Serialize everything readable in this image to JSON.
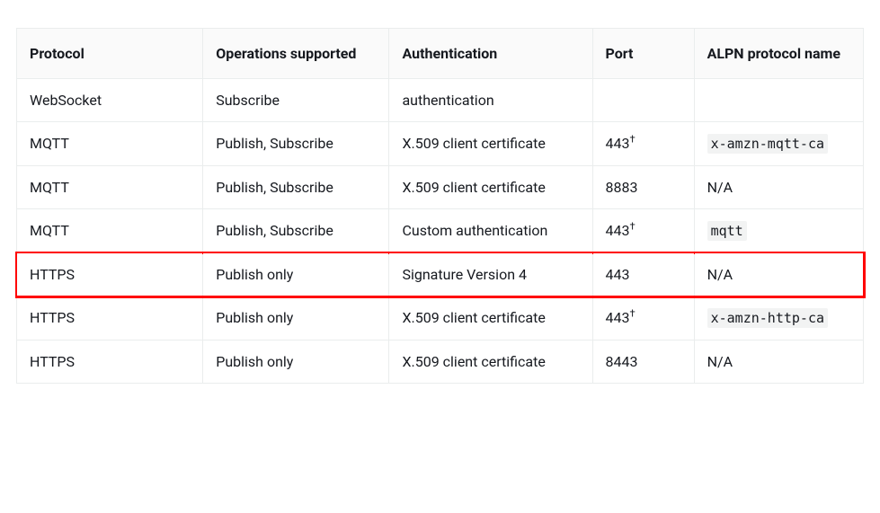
{
  "table": {
    "headers": {
      "protocol": "Protocol",
      "operations": "Operations supported",
      "auth": "Authentication",
      "port": "Port",
      "alpn": "ALPN protocol name"
    },
    "rows": [
      {
        "protocol": "WebSocket",
        "operations": "Subscribe",
        "auth": "authentication",
        "port": "",
        "port_dagger": false,
        "alpn": "",
        "alpn_code": false,
        "highlighted": false
      },
      {
        "protocol": "MQTT",
        "operations": "Publish, Subscribe",
        "auth": "X.509 client certificate",
        "port": "443",
        "port_dagger": true,
        "alpn": "x-amzn-mqtt-ca",
        "alpn_code": true,
        "highlighted": false
      },
      {
        "protocol": "MQTT",
        "operations": "Publish, Subscribe",
        "auth": "X.509 client certificate",
        "port": "8883",
        "port_dagger": false,
        "alpn": "N/A",
        "alpn_code": false,
        "highlighted": false
      },
      {
        "protocol": "MQTT",
        "operations": "Publish, Subscribe",
        "auth": "Custom authentication",
        "port": "443",
        "port_dagger": true,
        "alpn": "mqtt",
        "alpn_code": true,
        "highlighted": false
      },
      {
        "protocol": "HTTPS",
        "operations": "Publish only",
        "auth": "Signature Version 4",
        "port": "443",
        "port_dagger": false,
        "alpn": "N/A",
        "alpn_code": false,
        "highlighted": true
      },
      {
        "protocol": "HTTPS",
        "operations": "Publish only",
        "auth": "X.509 client certificate",
        "port": "443",
        "port_dagger": true,
        "alpn": "x-amzn-http-ca",
        "alpn_code": true,
        "highlighted": false
      },
      {
        "protocol": "HTTPS",
        "operations": "Publish only",
        "auth": "X.509 client certificate",
        "port": "8443",
        "port_dagger": false,
        "alpn": "N/A",
        "alpn_code": false,
        "highlighted": false
      }
    ],
    "dagger": "†"
  }
}
